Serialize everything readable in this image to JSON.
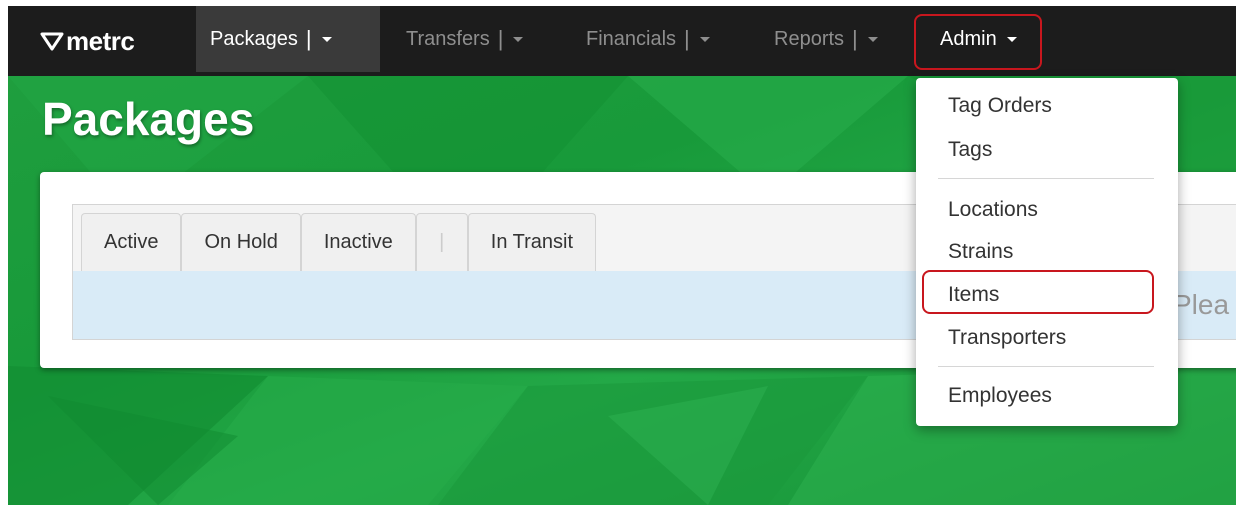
{
  "brand": {
    "name": "metrc"
  },
  "nav": [
    {
      "label": "Packages",
      "sep": "|"
    },
    {
      "label": "Transfers",
      "sep": "|"
    },
    {
      "label": "Financials",
      "sep": "|"
    },
    {
      "label": "Reports",
      "sep": "|"
    },
    {
      "label": "Admin"
    }
  ],
  "page": {
    "title": "Packages"
  },
  "tabs": [
    "Active",
    "On Hold",
    "Inactive",
    "|",
    "In Transit"
  ],
  "info_text": "Plea",
  "admin_menu": {
    "groups": [
      [
        "Tag Orders",
        "Tags"
      ],
      [
        "Locations",
        "Strains",
        "Items",
        "Transporters"
      ],
      [
        "Employees"
      ]
    ]
  },
  "colors": {
    "navbar": "#1c1c1c",
    "background": "#1f9e3e",
    "highlight": "#c8171e",
    "info_bar": "#d9ebf7"
  },
  "icons": {
    "logo": "metrc-logo-icon",
    "caret": "caret-down-icon"
  }
}
